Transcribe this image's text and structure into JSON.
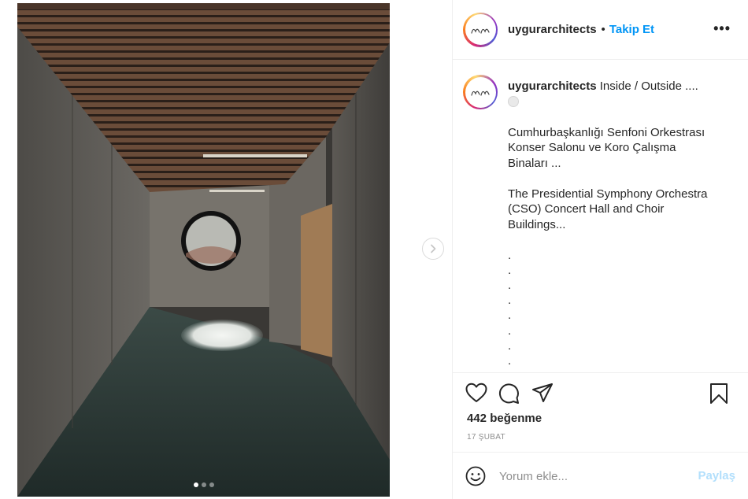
{
  "post": {
    "username": "uygurarchitects",
    "separator": "•",
    "follow_label": "Takip Et",
    "more_label": "•••",
    "avatar_monogram": "un",
    "image_dots": [
      {
        "active": true
      },
      {
        "active": false
      },
      {
        "active": false
      }
    ]
  },
  "caption": {
    "username": "uygurarchitects",
    "first_line": " Inside / Outside ....",
    "paragraph_tr": "Cumhurbaşkanlığı Senfoni Orkestrası Konser Salonu ve Koro Çalışma Binaları ...",
    "paragraph_en": "The Presidential Symphony Orchestra (CSO) Concert Hall and Choir Buildings...",
    "dots": [
      ".",
      ".",
      ".",
      ".",
      ".",
      ".",
      ".",
      "."
    ]
  },
  "actions": {
    "likes": "442 beğenme",
    "date": "17 ŞUBAT",
    "like_icon": "heart-icon",
    "comment_icon": "comment-icon",
    "share_icon": "paper-plane-icon",
    "save_icon": "bookmark-icon"
  },
  "comment": {
    "placeholder": "Yorum ekle...",
    "submit_label": "Paylaş"
  },
  "colors": {
    "link": "#0095f6",
    "submit_disabled": "#b2dffc",
    "muted": "#8e8e8e",
    "text": "#262626"
  }
}
